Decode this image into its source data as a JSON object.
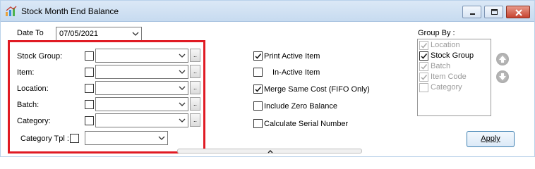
{
  "window": {
    "title": "Stock Month End Balance",
    "icon": "stock-report-icon",
    "controls": [
      "minimize-icon",
      "restore-icon",
      "close-icon"
    ]
  },
  "date_to": {
    "label": "Date To",
    "value": "07/05/2021"
  },
  "filters": [
    {
      "label": "Stock Group:",
      "checked": false,
      "value": ""
    },
    {
      "label": "Item:",
      "checked": false,
      "value": ""
    },
    {
      "label": "Location:",
      "checked": false,
      "value": ""
    },
    {
      "label": "Batch:",
      "checked": false,
      "value": ""
    },
    {
      "label": "Category:",
      "checked": false,
      "value": ""
    }
  ],
  "filter_lookup_label": "..",
  "category_tpl": {
    "label": "Category Tpl :",
    "checked": false,
    "value": ""
  },
  "options": [
    {
      "label": "Print Active Item",
      "checked": true
    },
    {
      "label": "In-Active Item",
      "checked": false
    },
    {
      "label": "Merge Same Cost (FIFO Only)",
      "checked": true
    },
    {
      "label": "Include Zero Balance",
      "checked": false
    },
    {
      "label": "Calculate Serial Number",
      "checked": false
    }
  ],
  "group_by": {
    "label": "Group By :",
    "items": [
      {
        "label": "Location",
        "checked": true,
        "enabled": false
      },
      {
        "label": "Stock Group",
        "checked": true,
        "enabled": true
      },
      {
        "label": "Batch",
        "checked": true,
        "enabled": false
      },
      {
        "label": "Item Code",
        "checked": true,
        "enabled": false
      },
      {
        "label": "Category",
        "checked": false,
        "enabled": false
      }
    ],
    "move_up_icon": "arrow-up-icon",
    "move_down_icon": "arrow-down-icon"
  },
  "apply_label": "Apply",
  "colors": {
    "highlight": "#e01b24",
    "titlebar": "#c7dbf0",
    "apply_border": "#3c7fb1"
  }
}
